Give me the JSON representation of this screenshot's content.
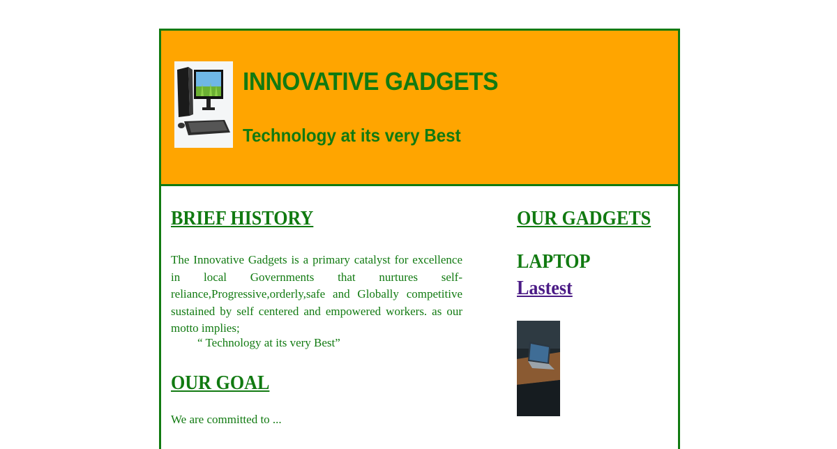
{
  "header": {
    "title": "INNOVATIVE GADGETS",
    "tagline": "Technology at its very Best",
    "logo_icon": "desktop-computer-icon"
  },
  "history": {
    "heading": "BRIEF HISTORY",
    "text": "The Innovative Gadgets is a primary catalyst for excellence in local Governments that nurtures self-reliance,Progressive,orderly,safe and Globally competitive sustained by self centered and empowered workers. as our motto implies;",
    "motto": "“ Technology at its very Best”"
  },
  "goal": {
    "heading": "OUR GOAL",
    "text": "We are committed to ... "
  },
  "gadgets": {
    "heading": "OUR GADGETS",
    "laptop_title": "LAPTOP",
    "latest_link": "Lastest",
    "photo_icon": "laptop-photo"
  },
  "colors": {
    "header_bg": "#ffa500",
    "text_green": "#117a11",
    "link_purple": "#4b1b86",
    "border": "#117a11"
  }
}
